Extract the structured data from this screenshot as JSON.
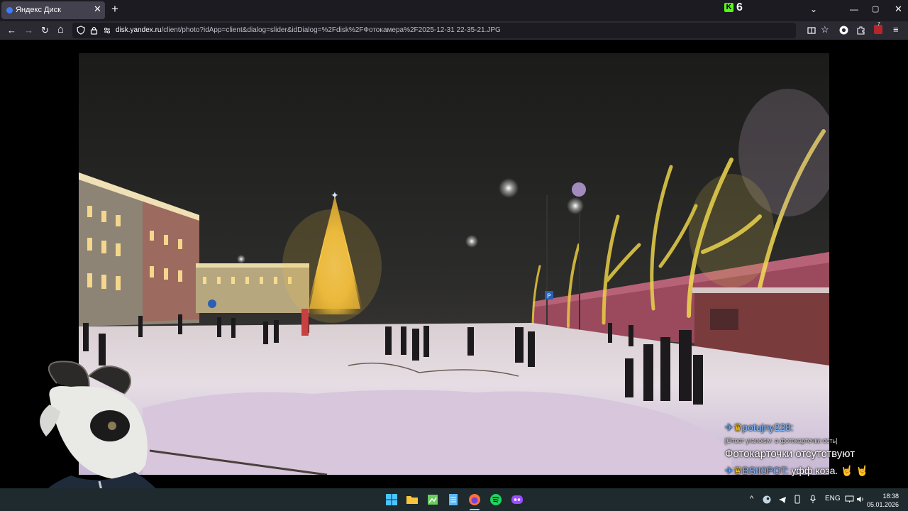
{
  "browser": {
    "tab": {
      "title": "Яндекс Диск",
      "close": "✕"
    },
    "new_tab": "+",
    "kick": {
      "logo": "K",
      "count": "6"
    },
    "window": {
      "list_tabs": "⌄",
      "minimize": "—",
      "maximize": "▢",
      "close": "✕"
    },
    "nav": {
      "back": "←",
      "forward": "→",
      "reload": "↻",
      "home": "⌂"
    },
    "url": {
      "domain": "disk.yandex.ru",
      "path": "/client/photo?idApp=client&dialog=slider&idDialog=%2Fdisk%2FФотокамера%2F2025-12-31 22-35-21.JPG"
    },
    "extensions": {
      "badge_count": "7"
    }
  },
  "chat": {
    "messages": [
      {
        "user": "potujny228:",
        "reply_note": "[Ответ yranoisiv: а фотокарточки есть]",
        "text": "Фотокарточки отсутствуют",
        "user_color": "#7fb8ff"
      },
      {
        "user": "BSII0POT:",
        "text": "уфф коза. 🤘 🤘",
        "user_color": "#7fb8ff"
      }
    ],
    "badges": {
      "sword": "✈",
      "crown": "♛"
    }
  },
  "taskbar": {
    "tray": {
      "lang": "ENG",
      "chevron": "^"
    },
    "clock": {
      "time": "18:38",
      "date": "05.01.2026"
    }
  },
  "colors": {
    "accent": "#3d7eff",
    "kick_green": "#53fc18",
    "taskbar_bg": "#1e2a2e"
  }
}
